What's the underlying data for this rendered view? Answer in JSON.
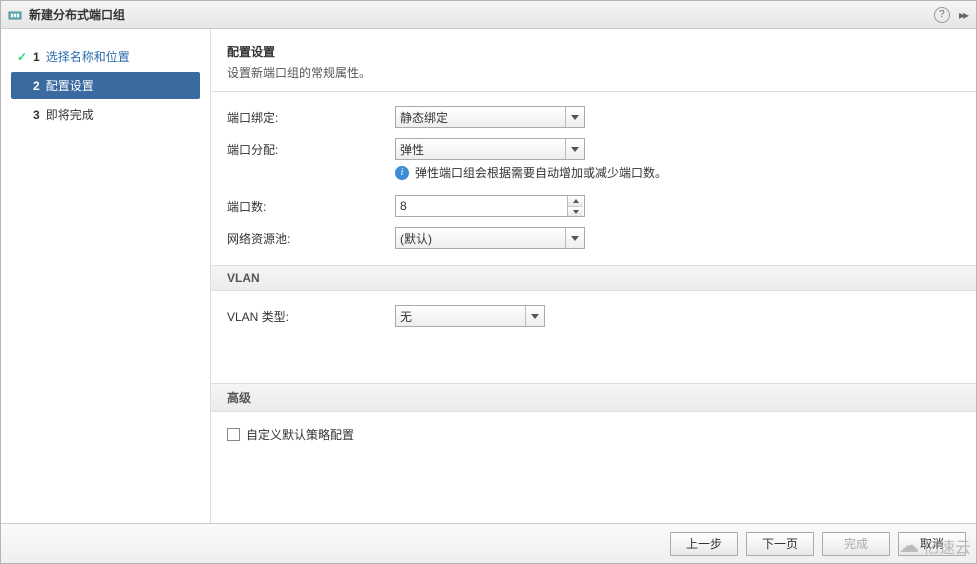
{
  "window": {
    "title": "新建分布式端口组"
  },
  "steps": {
    "s1": {
      "num": "1",
      "label": "选择名称和位置"
    },
    "s2": {
      "num": "2",
      "label": "配置设置"
    },
    "s3": {
      "num": "3",
      "label": "即将完成"
    }
  },
  "header": {
    "title": "配置设置",
    "desc": "设置新端口组的常规属性。"
  },
  "form": {
    "port_binding_label": "端口绑定:",
    "port_binding_value": "静态绑定",
    "port_alloc_label": "端口分配:",
    "port_alloc_value": "弹性",
    "port_alloc_info": "弹性端口组会根据需要自动增加或减少端口数。",
    "port_count_label": "端口数:",
    "port_count_value": "8",
    "net_pool_label": "网络资源池:",
    "net_pool_value": "(默认)"
  },
  "vlan": {
    "section": "VLAN",
    "type_label": "VLAN 类型:",
    "type_value": "无"
  },
  "advanced": {
    "section": "高级",
    "custom_default_label": "自定义默认策略配置"
  },
  "footer": {
    "back": "上一步",
    "next": "下一页",
    "finish": "完成",
    "cancel": "取消"
  },
  "watermark": {
    "text": "亿速云"
  }
}
